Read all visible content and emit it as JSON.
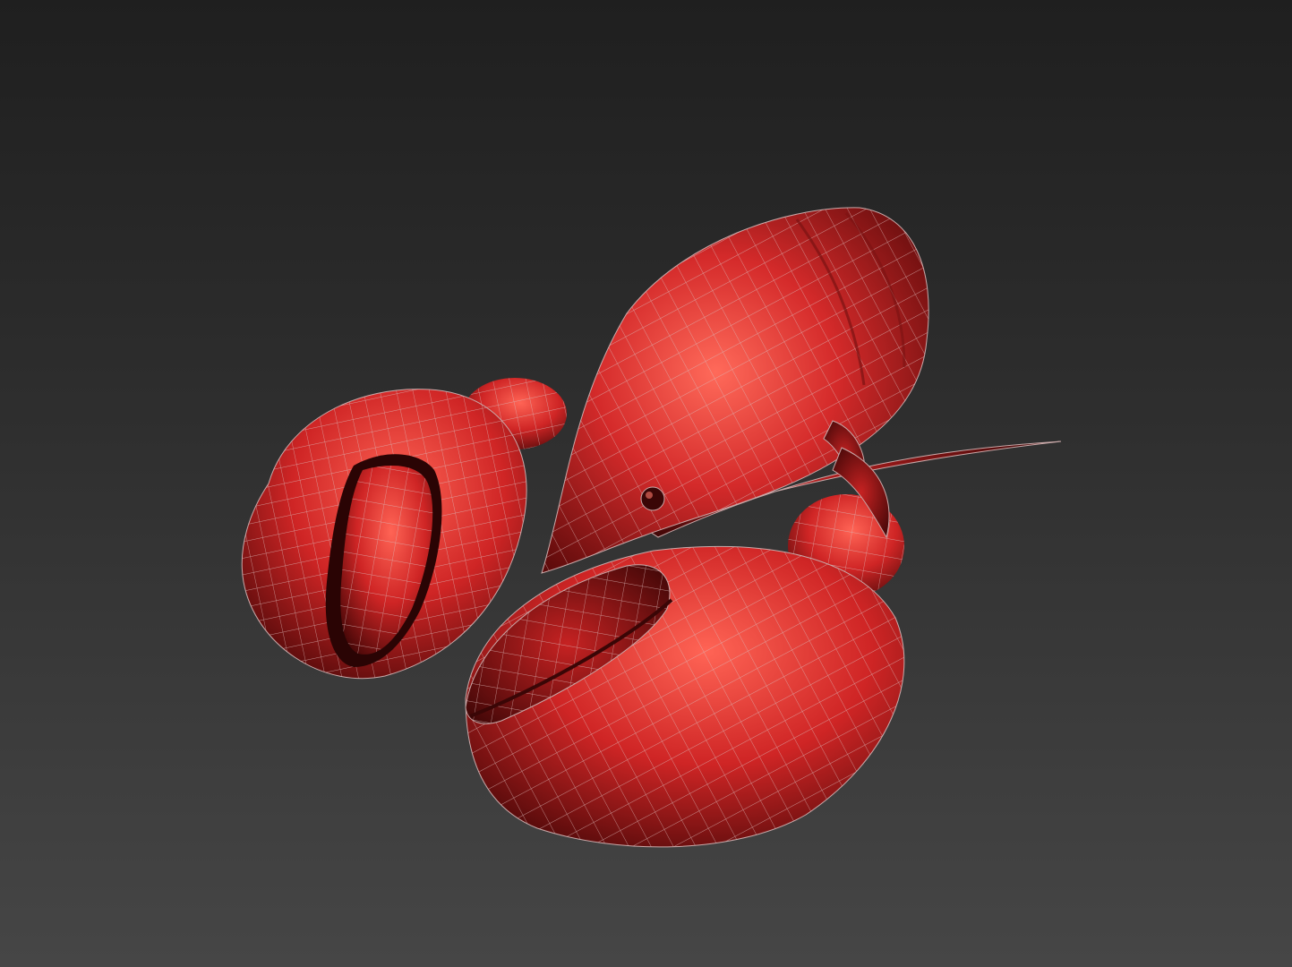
{
  "viewport": {
    "background_top": "#1f1f1f",
    "background_bottom": "#464646"
  },
  "model": {
    "subject": "lobster-wireframe-model",
    "surface_color": "#d42a2a",
    "highlight_color": "#ff6a5a",
    "shadow_color": "#5a0a0a",
    "wire_color": "#c9a9a9"
  }
}
